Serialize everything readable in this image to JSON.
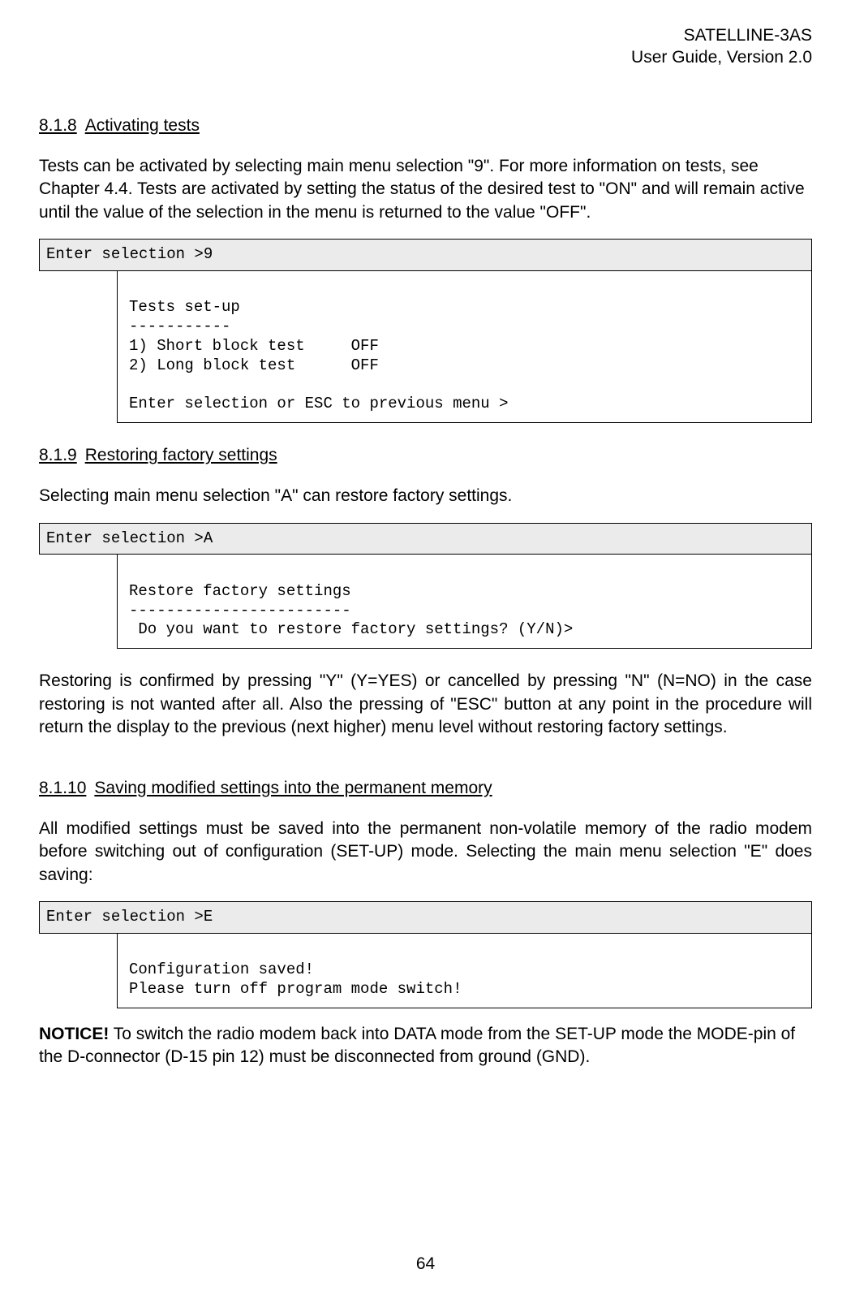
{
  "header": {
    "line1": "SATELLINE-3AS",
    "line2": "User Guide, Version 2.0"
  },
  "sec818": {
    "num": "8.1.8",
    "title": "Activating tests",
    "para": "Tests can be activated by selecting main menu selection \"9\". For more information on tests, see Chapter 4.4. Tests are activated by setting the status of the desired test to \"ON\" and will remain active until the value of the selection in the menu is returned to the value \"OFF\".",
    "prompt": "Enter selection >9",
    "term": "\nTests set-up\n-----------\n1) Short block test     OFF\n2) Long block test      OFF\n\nEnter selection or ESC to previous menu >"
  },
  "sec819": {
    "num": "8.1.9",
    "title": "Restoring factory settings",
    "para1": "Selecting main menu selection \"A\" can restore factory settings.",
    "prompt": "Enter selection >A",
    "term": "\nRestore factory settings\n------------------------\n Do you want to restore factory settings? (Y/N)>",
    "para2": "Restoring is confirmed by pressing \"Y\" (Y=YES) or cancelled by pressing \"N\" (N=NO) in the case restoring is not wanted after all. Also the pressing of \"ESC\" button at any point in the procedure will return the display to the previous (next higher) menu level without restoring factory settings."
  },
  "sec8110": {
    "num": "8.1.10",
    "title": "Saving modified settings into the permanent memory",
    "para": "All modified settings must be saved into the permanent non-volatile memory of the radio modem before switching out of configuration (SET-UP) mode. Selecting the main menu selection \"E\" does saving:",
    "prompt": "Enter selection >E",
    "term": "\nConfiguration saved!\nPlease turn off program mode switch!"
  },
  "notice": {
    "label": "NOTICE!",
    "text": " To switch the radio modem back into DATA mode from the SET-UP mode the MODE-pin of the D-connector (D-15 pin 12) must be disconnected from ground (GND)."
  },
  "page": "64"
}
